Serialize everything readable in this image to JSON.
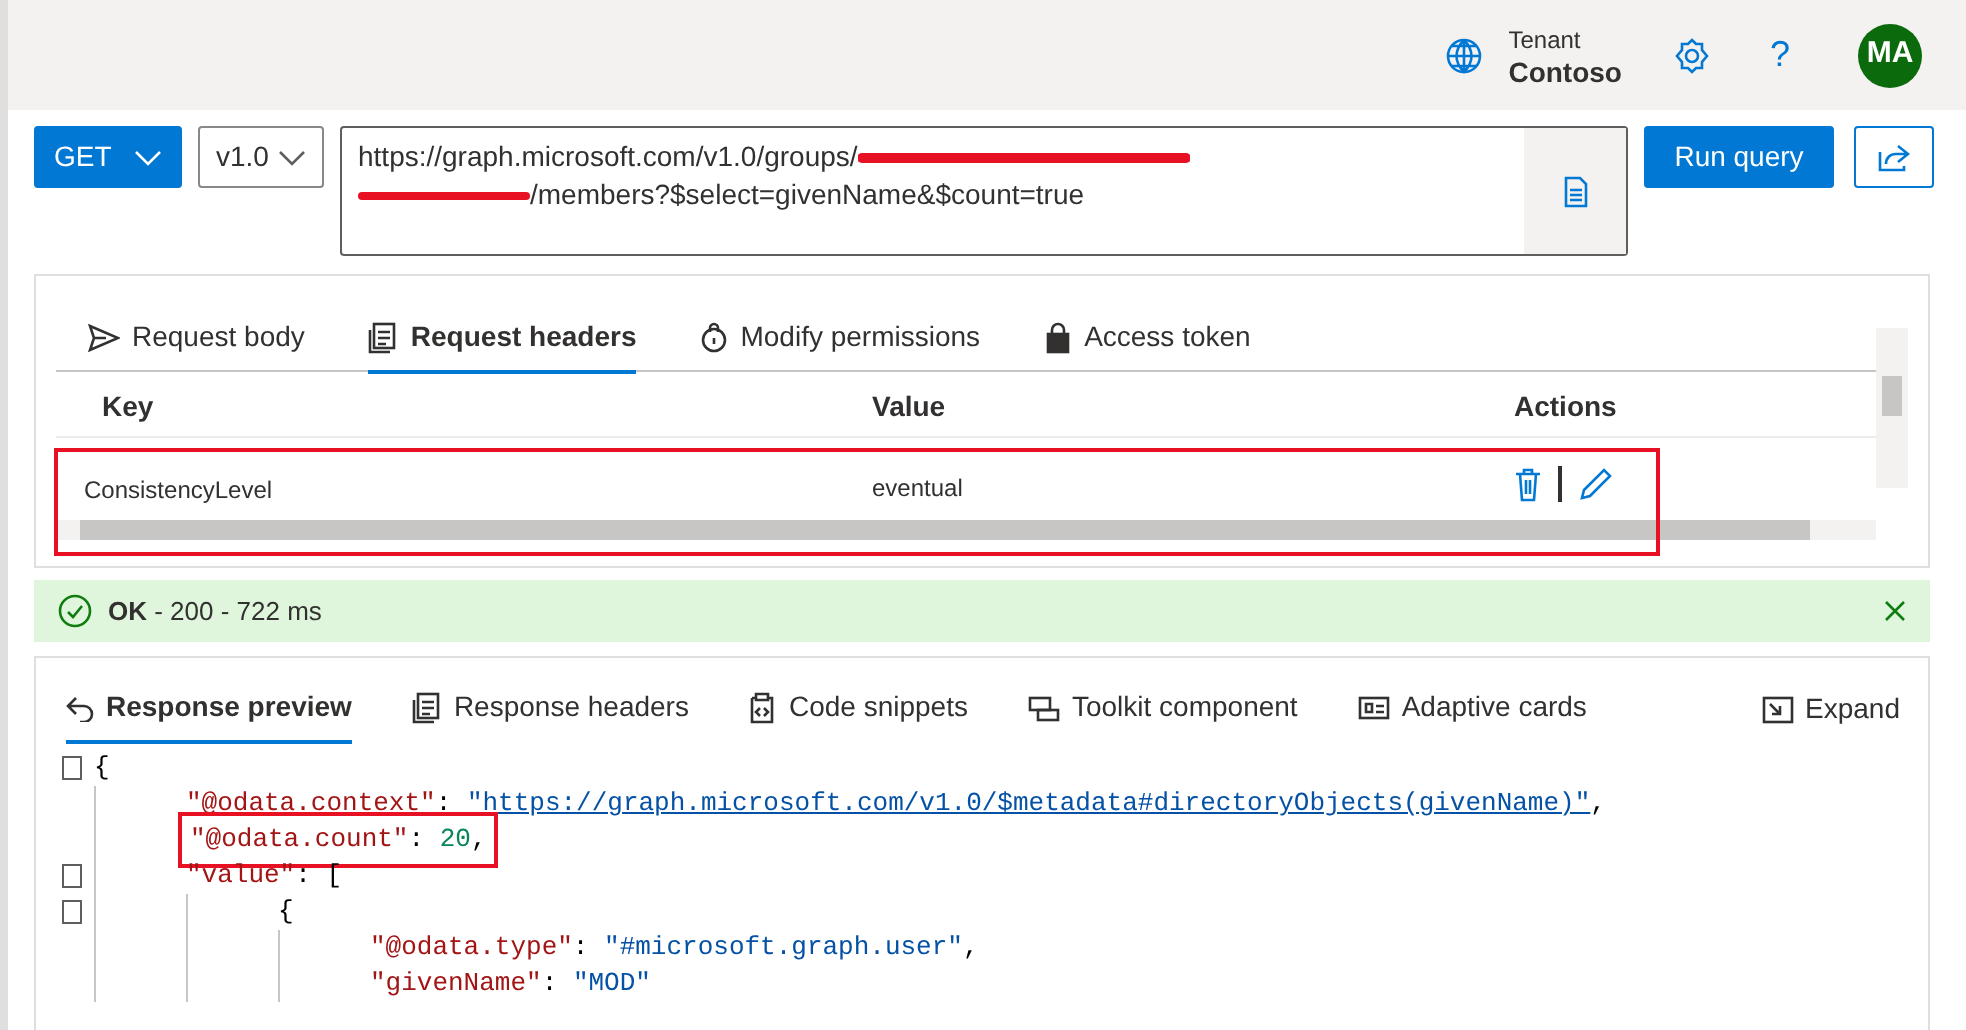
{
  "header": {
    "tenant_label": "Tenant",
    "tenant_name": "Contoso",
    "help": "?",
    "avatar_initials": "MA"
  },
  "query": {
    "method": "GET",
    "version": "v1.0",
    "url_start": "https://graph.microsoft.com/v1.0/groups/",
    "url_end": "/members?$select=givenName&$count=true",
    "run_button": "Run query"
  },
  "request_tabs": [
    {
      "label": "Request body",
      "selected": false
    },
    {
      "label": "Request headers",
      "selected": true
    },
    {
      "label": "Modify permissions",
      "selected": false
    },
    {
      "label": "Access token",
      "selected": false
    }
  ],
  "headers_table": {
    "columns": [
      "Key",
      "Value",
      "Actions"
    ],
    "rows": [
      {
        "key": "ConsistencyLevel",
        "value": "eventual"
      }
    ]
  },
  "status": {
    "ok": "OK",
    "detail": " - 200 - 722 ms"
  },
  "response_tabs": [
    {
      "label": "Response preview",
      "selected": true
    },
    {
      "label": "Response headers",
      "selected": false
    },
    {
      "label": "Code snippets",
      "selected": false
    },
    {
      "label": "Toolkit component",
      "selected": false
    },
    {
      "label": "Adaptive cards",
      "selected": false
    }
  ],
  "expand_button": "Expand",
  "code": [
    {
      "fold": true,
      "tokens": [
        {
          "kind": "punct",
          "text": "{"
        }
      ],
      "children": [
        {
          "fold": false,
          "highlight": false,
          "tokens": [
            {
              "kind": "key",
              "text": "\"@odata.context\""
            },
            {
              "kind": "punct",
              "text": ": "
            },
            {
              "kind": "link",
              "text": "\"https://graph.microsoft.com/v1.0/$metadata#directoryObjects(givenName)\""
            },
            {
              "kind": "punct",
              "text": ","
            }
          ]
        },
        {
          "fold": false,
          "highlight": true,
          "tokens": [
            {
              "kind": "key",
              "text": "\"@odata.count\""
            },
            {
              "kind": "punct",
              "text": ": "
            },
            {
              "kind": "number",
              "text": "20"
            },
            {
              "kind": "punct",
              "text": ","
            }
          ]
        },
        {
          "fold": true,
          "highlight": false,
          "tokens": [
            {
              "kind": "key",
              "text": "\"value\""
            },
            {
              "kind": "punct",
              "text": ": ["
            }
          ],
          "children": [
            {
              "fold": true,
              "highlight": false,
              "tokens": [
                {
                  "kind": "punct",
                  "text": "{"
                }
              ],
              "children": [
                {
                  "fold": false,
                  "highlight": false,
                  "tokens": [
                    {
                      "kind": "key",
                      "text": "\"@odata.type\""
                    },
                    {
                      "kind": "punct",
                      "text": ": "
                    },
                    {
                      "kind": "string",
                      "text": "\"#microsoft.graph.user\""
                    },
                    {
                      "kind": "punct",
                      "text": ","
                    }
                  ]
                },
                {
                  "fold": false,
                  "highlight": false,
                  "tokens": [
                    {
                      "kind": "key",
                      "text": "\"givenName\""
                    },
                    {
                      "kind": "punct",
                      "text": ": "
                    },
                    {
                      "kind": "string",
                      "text": "\"MOD\""
                    }
                  ]
                }
              ]
            }
          ]
        }
      ]
    }
  ]
}
